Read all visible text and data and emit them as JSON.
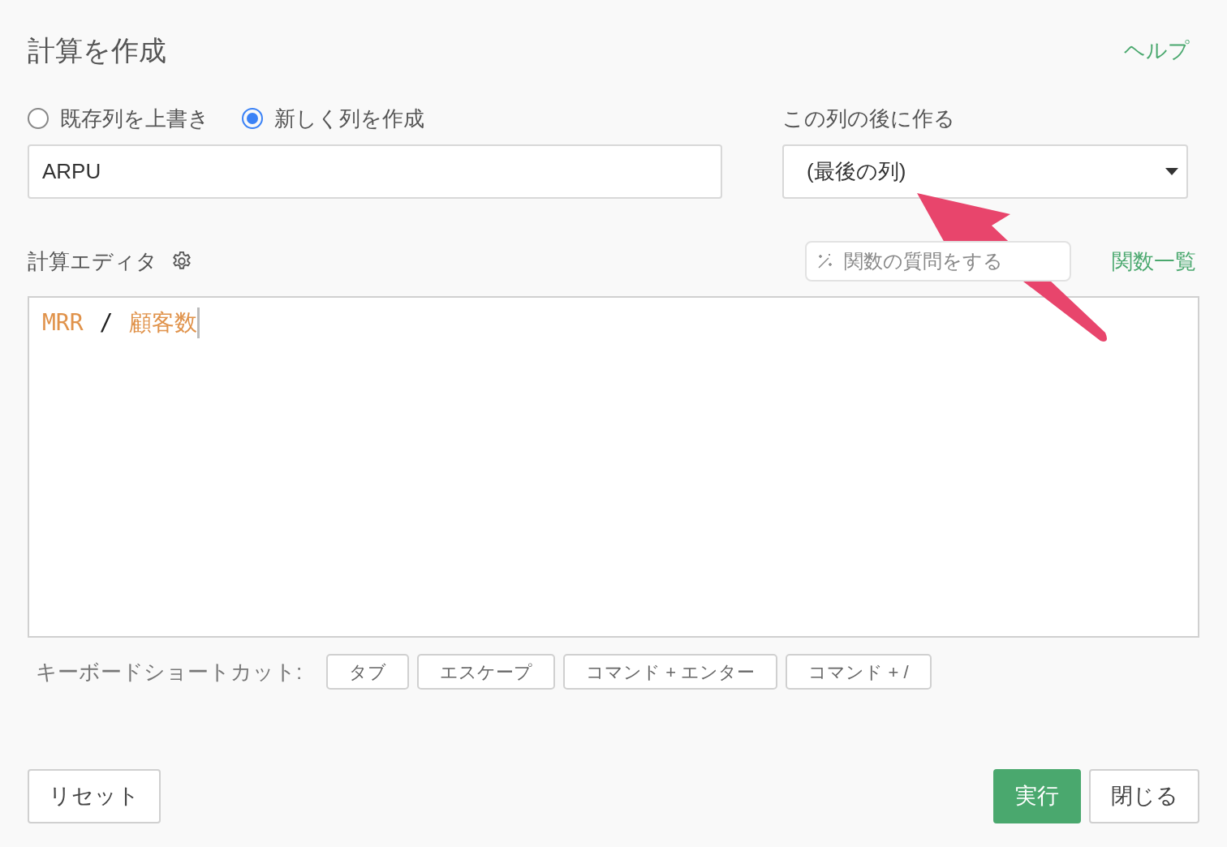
{
  "dialog": {
    "title": "計算を作成",
    "help_link": "ヘルプ"
  },
  "mode_options": [
    {
      "label": "既存列を上書き",
      "selected": false
    },
    {
      "label": "新しく列を作成",
      "selected": true
    }
  ],
  "column_name": {
    "value": "ARPU"
  },
  "position": {
    "label": "この列の後に作る",
    "value": "(最後の列)"
  },
  "editor": {
    "label": "計算エディタ",
    "ask_placeholder": "関数の質問をする",
    "function_list_link": "関数一覧",
    "tokens": [
      {
        "kind": "column",
        "text": "MRR"
      },
      {
        "kind": "operator",
        "text": "/"
      },
      {
        "kind": "column",
        "text": "顧客数"
      }
    ]
  },
  "shortcuts": {
    "label": "キーボードショートカット:",
    "keys": [
      "タブ",
      "エスケープ",
      "コマンド + エンター",
      "コマンド + /"
    ]
  },
  "buttons": {
    "reset": "リセット",
    "run": "実行",
    "close": "閉じる"
  }
}
